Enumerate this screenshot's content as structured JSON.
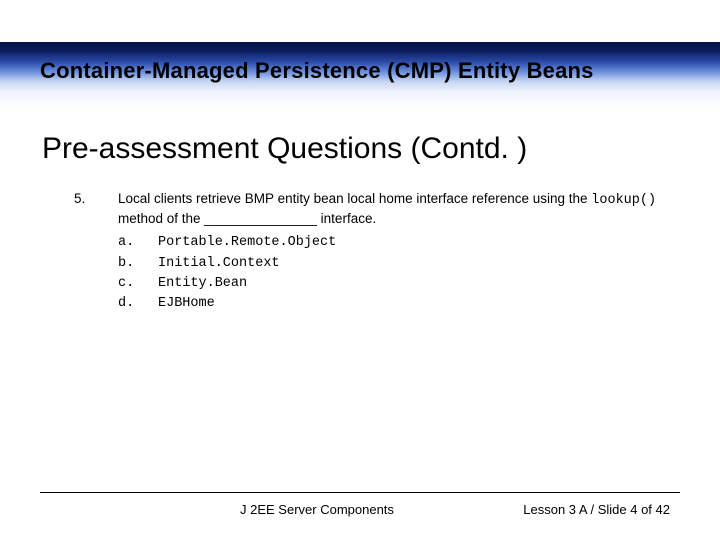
{
  "header": {
    "title": "Container-Managed Persistence (CMP) Entity Beans"
  },
  "section": {
    "title": "Pre-assessment Questions (Contd. )"
  },
  "question": {
    "number": "5.",
    "text_pre": "Local clients retrieve BMP entity bean local home interface reference using the ",
    "code": "lookup()",
    "text_post": " method of the _______________ interface.",
    "options": [
      {
        "label": "a.",
        "value": "Portable.Remote.Object"
      },
      {
        "label": "b.",
        "value": "Initial.Context"
      },
      {
        "label": "c.",
        "value": "Entity.Bean"
      },
      {
        "label": "d.",
        "value": "EJBHome"
      }
    ]
  },
  "footer": {
    "left": "J 2EE Server Components",
    "right": "Lesson 3 A / Slide 4 of 42"
  }
}
